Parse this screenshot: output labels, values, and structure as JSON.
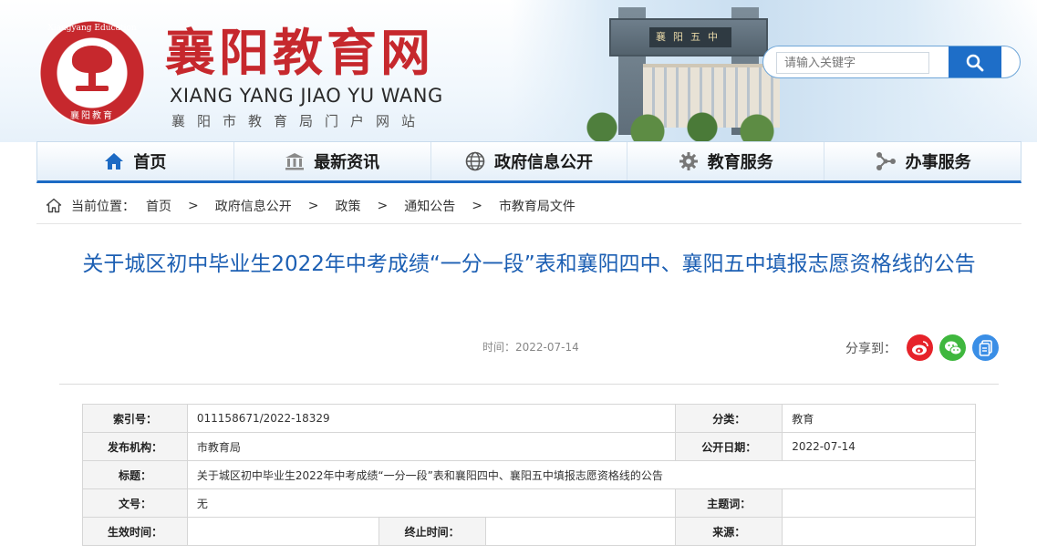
{
  "header": {
    "site_title": "襄阳教育网",
    "pinyin": "XIANG YANG JIAO YU WANG",
    "subtitle": "襄阳市教育局门户网站",
    "logo_ring_text": "Xiangyang Education",
    "logo_bottom_text": "襄阳教育",
    "gate_plaque": "襄阳五中"
  },
  "search": {
    "placeholder": "请输入关键字",
    "icon": "search-icon"
  },
  "nav": {
    "items": [
      {
        "label": "首页",
        "icon": "home-icon"
      },
      {
        "label": "最新资讯",
        "icon": "building-icon"
      },
      {
        "label": "政府信息公开",
        "icon": "globe-icon"
      },
      {
        "label": "教育服务",
        "icon": "gear-icon"
      },
      {
        "label": "办事服务",
        "icon": "network-icon"
      }
    ]
  },
  "breadcrumb": {
    "label": "当前位置：",
    "items": [
      "首页",
      "政府信息公开",
      "政策",
      "通知公告",
      "市教育局文件"
    ],
    "separator": ">"
  },
  "article": {
    "title": "关于城区初中毕业生2022年中考成绩“一分一段”表和襄阳四中、襄阳五中填报志愿资格线的公告",
    "time": "时间：2022-07-14",
    "share_label": "分享到："
  },
  "info": {
    "index_label": "索引号：",
    "index_value": "011158671/2022-18329",
    "category_label": "分类：",
    "category_value": "教育",
    "publisher_label": "发布机构：",
    "publisher_value": "市教育局",
    "pubdate_label": "公开日期：",
    "pubdate_value": "2022-07-14",
    "title_label": "标题：",
    "title_value": "关于城区初中毕业生2022年中考成绩“一分一段”表和襄阳四中、襄阳五中填报志愿资格线的公告",
    "docno_label": "文号：",
    "docno_value": "无",
    "keywords_label": "主题词：",
    "keywords_value": "",
    "effective_label": "生效时间：",
    "effective_value": "",
    "expiry_label": "终止时间：",
    "expiry_value": "",
    "source_label": "来源：",
    "source_value": ""
  },
  "colors": {
    "brand_red": "#c6282d",
    "title_blue": "#1c5fb3",
    "nav_accent": "#1c6ac4"
  }
}
